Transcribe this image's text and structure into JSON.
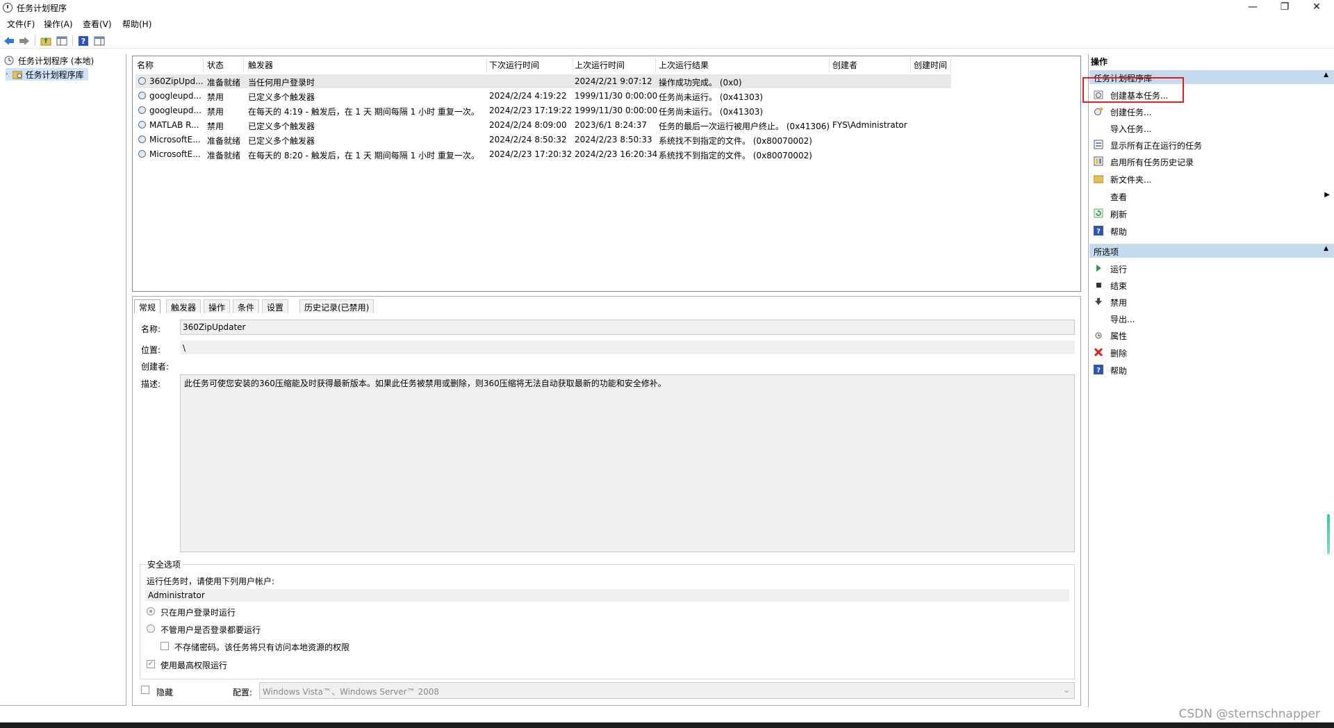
{
  "window": {
    "title": "任务计划程序",
    "minimize": "—",
    "restore": "❐",
    "close": "✕"
  },
  "menu": [
    "文件(F)",
    "操作(A)",
    "查看(V)",
    "帮助(H)"
  ],
  "tree": {
    "root": "任务计划程序 (本地)",
    "child": "任务计划程序库"
  },
  "columns": [
    "名称",
    "状态",
    "触发器",
    "下次运行时间",
    "上次运行时间",
    "上次运行结果",
    "创建者",
    "创建时间"
  ],
  "tasks": [
    {
      "name": "360ZipUpd...",
      "status": "准备就绪",
      "trigger": "当任何用户登录时",
      "next": "",
      "last": "2024/2/21 9:07:12",
      "result": "操作成功完成。 (0x0)",
      "author": "",
      "created": ""
    },
    {
      "name": "googleupd...",
      "status": "禁用",
      "trigger": "已定义多个触发器",
      "next": "2024/2/24 4:19:22",
      "last": "1999/11/30 0:00:00",
      "result": "任务尚未运行。 (0x41303)",
      "author": "",
      "created": ""
    },
    {
      "name": "googleupd...",
      "status": "禁用",
      "trigger": "在每天的 4:19 - 触发后，在 1 天 期间每隔 1 小时 重复一次。",
      "next": "2024/2/23 17:19:22",
      "last": "1999/11/30 0:00:00",
      "result": "任务尚未运行。 (0x41303)",
      "author": "",
      "created": ""
    },
    {
      "name": "MATLAB R...",
      "status": "禁用",
      "trigger": "已定义多个触发器",
      "next": "2024/2/24 8:09:00",
      "last": "2023/6/1 8:24:37",
      "result": "任务的最后一次运行被用户终止。 (0x41306)",
      "author": "FYS\\Administrator",
      "created": ""
    },
    {
      "name": "MicrosoftE...",
      "status": "准备就绪",
      "trigger": "已定义多个触发器",
      "next": "2024/2/24 8:50:32",
      "last": "2024/2/23 8:50:33",
      "result": "系统找不到指定的文件。 (0x80070002)",
      "author": "",
      "created": ""
    },
    {
      "name": "MicrosoftE...",
      "status": "准备就绪",
      "trigger": "在每天的 8:20 - 触发后，在 1 天 期间每隔 1 小时 重复一次。",
      "next": "2024/2/23 17:20:32",
      "last": "2024/2/23 16:20:34",
      "result": "系统找不到指定的文件。 (0x80070002)",
      "author": "",
      "created": ""
    }
  ],
  "detail_tabs": [
    "常规",
    "触发器",
    "操作",
    "条件",
    "设置",
    "历史记录(已禁用)"
  ],
  "details": {
    "name_label": "名称:",
    "name_value": "360ZipUpdater",
    "location_label": "位置:",
    "location_value": "\\",
    "author_label": "创建者:",
    "author_value": "",
    "desc_label": "描述:",
    "desc_value": "此任务可使您安装的360压缩能及时获得最新版本。如果此任务被禁用或删除，则360压缩将无法自动获取最新的功能和安全修补。",
    "security_title": "安全选项",
    "run_as_label": "运行任务时，请使用下列用户帐户:",
    "run_as_value": "Administrator",
    "opt_logged_on": "只在用户登录时运行",
    "opt_whether": "不管用户是否登录都要运行",
    "opt_no_store": "不存储密码。该任务将只有访问本地资源的权限",
    "opt_highest": "使用最高权限运行",
    "hidden_label": "隐藏",
    "config_label": "配置:",
    "config_value": "Windows Vista™、Windows Server™ 2008"
  },
  "actions": {
    "header": "操作",
    "section1": "任务计划程序库",
    "section1_items": [
      "创建基本任务...",
      "创建任务...",
      "导入任务...",
      "显示所有正在运行的任务",
      "启用所有任务历史记录",
      "新文件夹...",
      "查看",
      "刷新",
      "帮助"
    ],
    "section2": "所选项",
    "section2_items": [
      "运行",
      "结束",
      "禁用",
      "导出...",
      "属性",
      "删除",
      "帮助"
    ]
  },
  "watermark": "CSDN @sternschnapper",
  "colors": {
    "section_bg": "#c5d9ef",
    "highlight": "#e02020",
    "selected_row": "#e8e8e8"
  }
}
